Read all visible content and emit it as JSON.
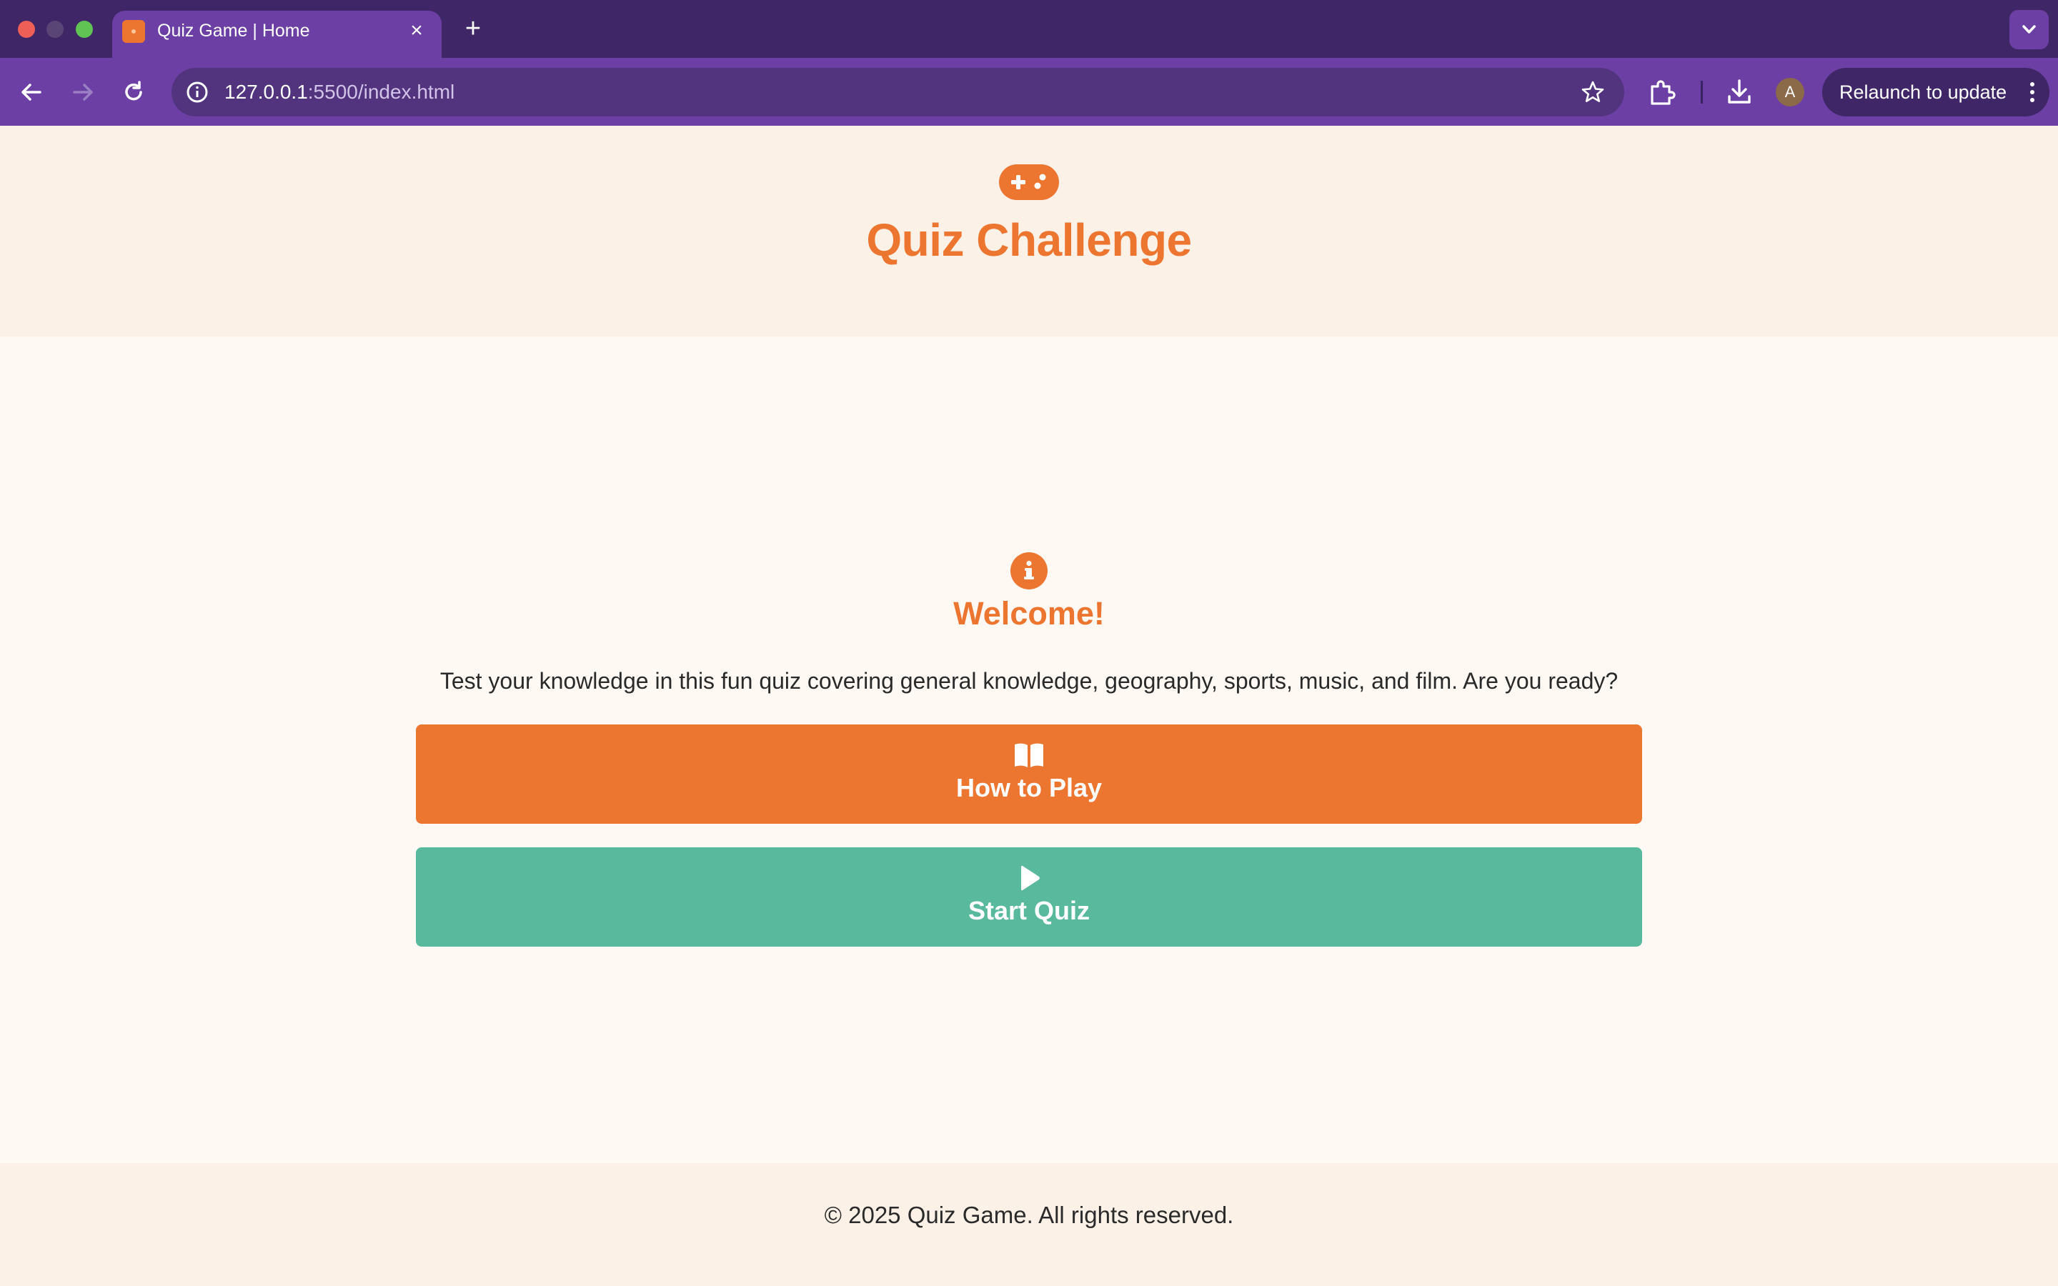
{
  "browser": {
    "tab_title": "Quiz Game | Home",
    "tab_close_glyph": "×",
    "new_tab_glyph": "+",
    "url_host": "127.0.0.1",
    "url_path": ":5500/index.html",
    "avatar_initial": "A",
    "relaunch_label": "Relaunch to update"
  },
  "header": {
    "icon": "gamepad-icon",
    "title": "Quiz Challenge"
  },
  "main": {
    "icon": "info-icon",
    "heading": "Welcome!",
    "intro": "Test your knowledge in this fun quiz covering general knowledge, geography, sports, music, and film. Are you ready?",
    "buttons": [
      {
        "label": "How to Play",
        "icon": "book-open-icon",
        "color": "#ec7530"
      },
      {
        "label": "Start Quiz",
        "icon": "play-icon",
        "color": "#59b99d"
      }
    ]
  },
  "footer": {
    "copyright": "© 2025 Quiz Game. All rights reserved."
  },
  "colors": {
    "accent": "#ec7530",
    "start": "#59b99d",
    "chrome_dark": "#3f2666",
    "chrome": "#6b3fa3",
    "header_bg": "#fcf1e7",
    "page_bg": "#fff8f3"
  }
}
